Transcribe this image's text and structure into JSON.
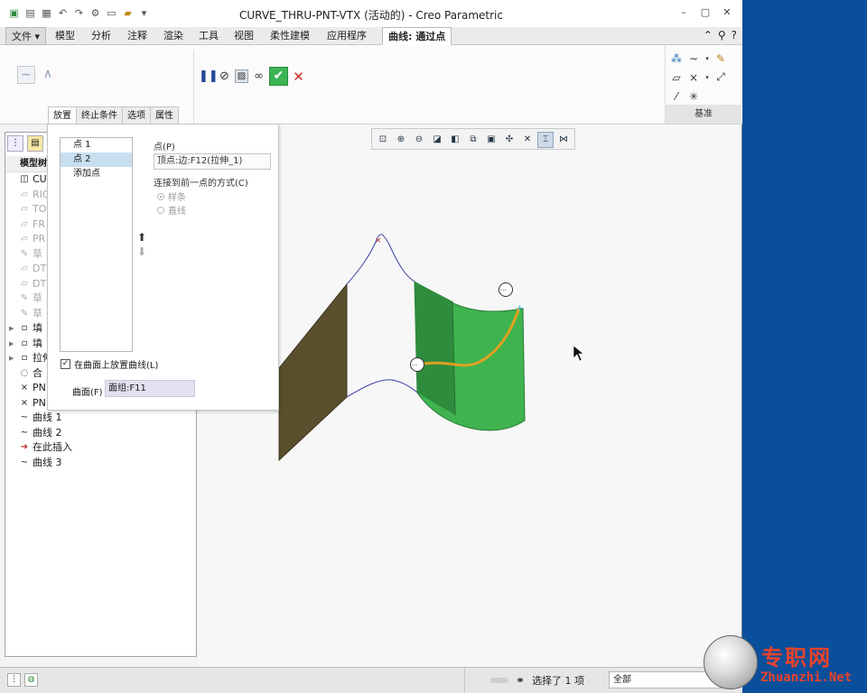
{
  "window": {
    "title": "CURVE_THRU-PNT-VTX (活动的) - Creo Parametric",
    "controls": [
      "–",
      "▢",
      "✕"
    ]
  },
  "quick_access": [
    "new-icon",
    "open-icon",
    "save-icon",
    "undo-icon",
    "redo-icon",
    "regenerate-icon",
    "windows-icon",
    "close-icon",
    "more-icon"
  ],
  "menu": {
    "file": "文件",
    "tabs": [
      "模型",
      "分析",
      "注释",
      "渲染",
      "工具",
      "视图",
      "柔性建模",
      "应用程序"
    ],
    "active_tab": "曲线: 通过点"
  },
  "ribbon": {
    "subtabs": [
      "放置",
      "终止条件",
      "选项",
      "属性"
    ],
    "datum_label": "基准"
  },
  "panel": {
    "points": [
      "点 1",
      "点 2",
      "添加点"
    ],
    "point_label": "点(P)",
    "point_value": "顶点:边:F12(拉伸_1)",
    "connect_label": "连接到前一点的方式(C)",
    "option_spline": "样条",
    "option_line": "直线",
    "on_surface_label": "在曲面上放置曲线(L)",
    "surface_label": "曲面(F)",
    "surface_value": "面组:F11"
  },
  "tree": {
    "header": "模型树",
    "items": [
      {
        "label": "CURVE",
        "dim": false,
        "expand": false
      },
      {
        "label": "RIG",
        "dim": true,
        "expand": false
      },
      {
        "label": "TO",
        "dim": true,
        "expand": false
      },
      {
        "label": "FR",
        "dim": true,
        "expand": false
      },
      {
        "label": "PR",
        "dim": true,
        "expand": false
      },
      {
        "label": "草",
        "dim": true,
        "expand": false
      },
      {
        "label": "DT",
        "dim": true,
        "expand": false
      },
      {
        "label": "DT",
        "dim": true,
        "expand": false
      },
      {
        "label": "草",
        "dim": true,
        "expand": false
      },
      {
        "label": "草",
        "dim": true,
        "expand": false
      },
      {
        "label": "填",
        "dim": false,
        "expand": true
      },
      {
        "label": "填",
        "dim": false,
        "expand": true
      },
      {
        "label": "拉伸",
        "dim": false,
        "expand": true
      },
      {
        "label": "合",
        "dim": false,
        "expand": false
      },
      {
        "label": "PN",
        "dim": false,
        "expand": false
      },
      {
        "label": "PN",
        "dim": false,
        "expand": false
      },
      {
        "label": "曲线 1",
        "dim": false,
        "expand": false
      },
      {
        "label": "曲线 2",
        "dim": false,
        "expand": false
      },
      {
        "label": "在此插入",
        "dim": false,
        "expand": false
      },
      {
        "label": "曲线 3",
        "dim": false,
        "expand": false
      }
    ]
  },
  "status": {
    "selected": "选择了 1 项",
    "filter": "全部"
  },
  "watermark": {
    "cn": "专职网",
    "en": "Zhuanzhi.Net"
  },
  "colors": {
    "accent_green": "#3cb454",
    "cancel_red": "#d12a2a",
    "surface_green": "#3fb34f",
    "surface_olive": "#5a4f2c",
    "curve_orange": "#e0a020",
    "desktop_blue": "#0a4f9c",
    "watermark_red": "#e8432a"
  }
}
